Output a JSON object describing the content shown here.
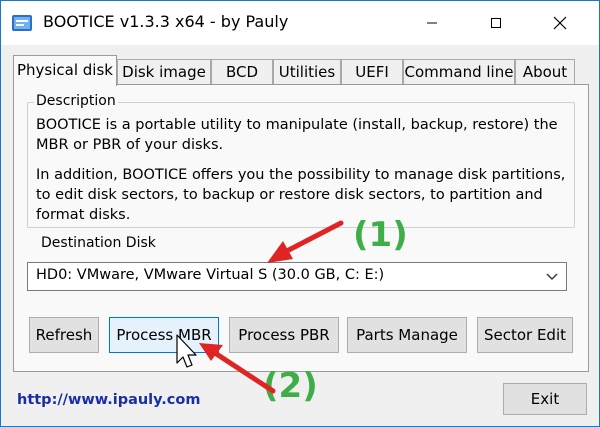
{
  "window": {
    "title": "BOOTICE v1.3.3 x64 - by Pauly"
  },
  "tabs": [
    {
      "label": "Physical disk"
    },
    {
      "label": "Disk image"
    },
    {
      "label": "BCD"
    },
    {
      "label": "Utilities"
    },
    {
      "label": "UEFI"
    },
    {
      "label": "Command line"
    },
    {
      "label": "About"
    }
  ],
  "description": {
    "label": "Description",
    "para1": "BOOTICE is a portable utility to manipulate (install, backup, restore) the MBR or PBR of your disks.",
    "para2": "In addition, BOOTICE offers you the possibility to manage disk partitions, to edit disk sectors, to backup or restore disk sectors, to partition and format disks."
  },
  "destination": {
    "label": "Destination Disk",
    "selected": "HD0: VMware, VMware Virtual S (30.0 GB, C: E:)"
  },
  "buttons": {
    "refresh": "Refresh",
    "process_mbr": "Process MBR",
    "process_pbr": "Process PBR",
    "parts_manage": "Parts Manage",
    "sector_edit": "Sector Edit",
    "exit": "Exit"
  },
  "footer": {
    "link": "http://www.ipauly.com"
  },
  "annotations": {
    "step1": "(1)",
    "step2": "(2)"
  },
  "colors": {
    "annotation_text": "#3fae49",
    "arrow": "#e02424",
    "link": "#1a2fa6",
    "accent": "#0078d7"
  }
}
